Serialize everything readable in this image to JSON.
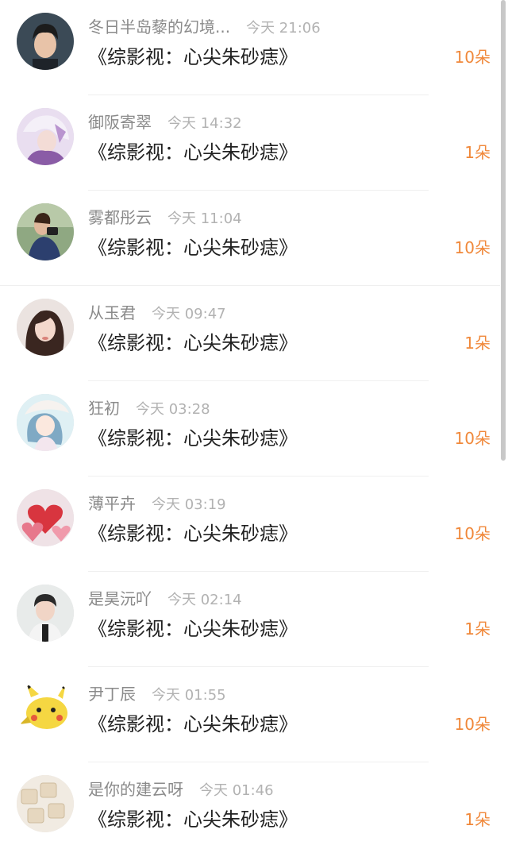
{
  "rows": [
    {
      "username": "冬日半岛藜的幻境...",
      "time": "今天 21:06",
      "book": "《综影视：心尖朱砂痣》",
      "amount": "10朵",
      "avatar": "person-dark-hair-icon"
    },
    {
      "username": "御阪寄翠",
      "time": "今天 14:32",
      "book": "《综影视：心尖朱砂痣》",
      "amount": "1朵",
      "avatar": "anime-character-icon"
    },
    {
      "username": "雾都彤云",
      "time": "今天 11:04",
      "book": "《综影视：心尖朱砂痣》",
      "amount": "10朵",
      "avatar": "person-camera-icon"
    },
    {
      "username": "从玉君",
      "time": "今天 09:47",
      "book": "《综影视：心尖朱砂痣》",
      "amount": "1朵",
      "avatar": "woman-portrait-icon"
    },
    {
      "username": "狂初",
      "time": "今天 03:28",
      "book": "《综影视：心尖朱砂痣》",
      "amount": "10朵",
      "avatar": "anime-girl-icon"
    },
    {
      "username": "薄平卉",
      "time": "今天 03:19",
      "book": "《综影视：心尖朱砂痣》",
      "amount": "10朵",
      "avatar": "hearts-icon"
    },
    {
      "username": "是昊沅吖",
      "time": "今天 02:14",
      "book": "《综影视：心尖朱砂痣》",
      "amount": "1朵",
      "avatar": "person-portrait-icon"
    },
    {
      "username": "尹丁辰",
      "time": "今天 01:55",
      "book": "《综影视：心尖朱砂痣》",
      "amount": "10朵",
      "avatar": "pikachu-icon"
    },
    {
      "username": "是你的建云呀",
      "time": "今天 01:46",
      "book": "《综影视：心尖朱砂痣》",
      "amount": "1朵",
      "avatar": "keyboard-keys-icon"
    }
  ],
  "colors": {
    "amount": "#f0883a",
    "username": "#8a8a8a",
    "time": "#b2b2b2",
    "title": "#222222"
  }
}
